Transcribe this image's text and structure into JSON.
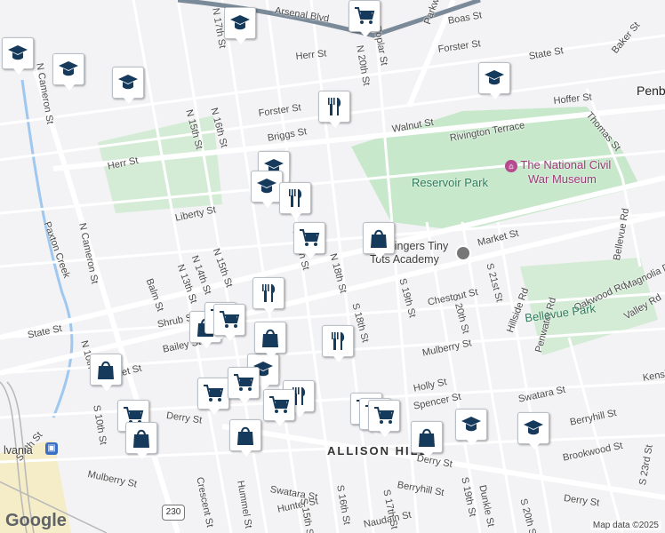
{
  "map": {
    "attribution": "Map data ©2025",
    "google_logo": "Google",
    "neighborhood": "ALLISON HILL",
    "city_partial": "Penb",
    "highway_shield": "230"
  },
  "parks": [
    {
      "name": "Reservoir Park"
    },
    {
      "name": "Bellevue Park"
    }
  ],
  "pois": [
    {
      "name": "The National Civil War Museum",
      "line1": "The National Civil",
      "line2": "War Museum",
      "kind": "museum"
    },
    {
      "name": "Tot Fingers Tiny Tots Academy",
      "line1": "Tot Fingers Tiny",
      "line2": "Tots Academy",
      "kind": "school"
    },
    {
      "name": "Pennsylvania station",
      "label": "lvania",
      "kind": "transit"
    }
  ],
  "streets": [
    {
      "name": "Arsenal Blvd"
    },
    {
      "name": "Boas St"
    },
    {
      "name": "Herr St"
    },
    {
      "name": "Forster St"
    },
    {
      "name": "State St"
    },
    {
      "name": "Baker St"
    },
    {
      "name": "Hoffer St"
    },
    {
      "name": "Walnut St"
    },
    {
      "name": "Thomas St"
    },
    {
      "name": "Rivington Terrace"
    },
    {
      "name": "Briggs St"
    },
    {
      "name": "Liberty St"
    },
    {
      "name": "Market St"
    },
    {
      "name": "Chestnut St"
    },
    {
      "name": "Mulberry St"
    },
    {
      "name": "Holly St"
    },
    {
      "name": "Spencer St"
    },
    {
      "name": "Swatara St"
    },
    {
      "name": "Derry St"
    },
    {
      "name": "Berryhill St"
    },
    {
      "name": "Brookwood St"
    },
    {
      "name": "Hunter St"
    },
    {
      "name": "Naudain St"
    },
    {
      "name": "Shrub St"
    },
    {
      "name": "Bailey St"
    },
    {
      "name": "Balm St"
    },
    {
      "name": "N Cameron St"
    },
    {
      "name": "Paxton Creek"
    },
    {
      "name": "N 10th St"
    },
    {
      "name": "S 10th St"
    },
    {
      "name": "N 13th St"
    },
    {
      "name": "N 14th St"
    },
    {
      "name": "N 15th St"
    },
    {
      "name": "N 16th St"
    },
    {
      "name": "N 17th St"
    },
    {
      "name": "N 18th St"
    },
    {
      "name": "N 20th St"
    },
    {
      "name": "Poplar St"
    },
    {
      "name": "Parkway Dr"
    },
    {
      "name": "S 15th St"
    },
    {
      "name": "S 16th St"
    },
    {
      "name": "S 17th St"
    },
    {
      "name": "S 18th St"
    },
    {
      "name": "S 19th St"
    },
    {
      "name": "S 20th St"
    },
    {
      "name": "S 21st St"
    },
    {
      "name": "S 23rd St"
    },
    {
      "name": "Hillside Rd"
    },
    {
      "name": "Oakwood Rd"
    },
    {
      "name": "Valley Rd"
    },
    {
      "name": "Magnolia Dr"
    },
    {
      "name": "Penwater Rd"
    },
    {
      "name": "Bellevue Rd"
    },
    {
      "name": "Dunkle St"
    },
    {
      "name": "Hummel St"
    },
    {
      "name": "Crescent St"
    },
    {
      "name": "S 4th St"
    },
    {
      "name": "Kensi"
    }
  ],
  "marker_counts": {
    "school": 10,
    "restaurant": 4,
    "grocery": 10,
    "shopping": 9
  }
}
